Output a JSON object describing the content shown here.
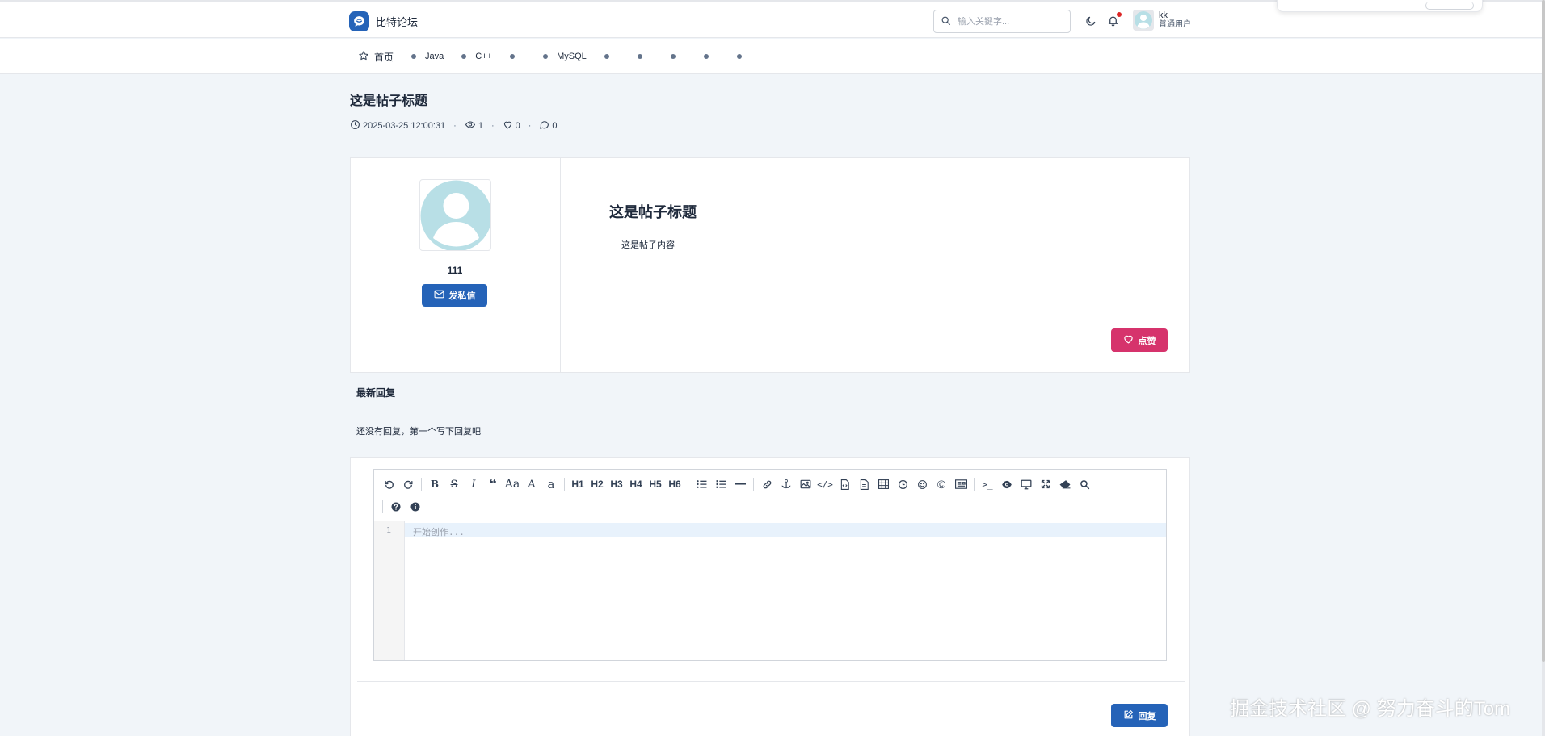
{
  "app": {
    "name": "比特论坛",
    "logo_icon": "chat-logo-icon",
    "brand_color": "#2563b8"
  },
  "search": {
    "placeholder": "输入关键字..."
  },
  "user": {
    "name": "kk",
    "role": "普通用户"
  },
  "nav": {
    "home": "首页",
    "categories": [
      "Java",
      "C++",
      "",
      "MySQL",
      "",
      "",
      "",
      "",
      ""
    ]
  },
  "post": {
    "title": "这是帖子标题",
    "datetime": "2025-03-25 12:00:31",
    "views": "1",
    "likes": "0",
    "comments": "0",
    "content_title": "这是帖子标题",
    "content_body": "这是帖子内容"
  },
  "author": {
    "name": "111",
    "message_button": "发私信"
  },
  "like_button": "点赞",
  "like_color": "#d6336c",
  "replies": {
    "heading": "最新回复",
    "empty_text": "还没有回复，第一个写下回复吧"
  },
  "editor": {
    "line_number": "1",
    "placeholder": "开始创作...",
    "headings": [
      "H1",
      "H2",
      "H3",
      "H4",
      "H5",
      "H6"
    ]
  },
  "reply_button": "回复",
  "watermark": "掘金技术社区 @ 努力奋斗的Tom"
}
